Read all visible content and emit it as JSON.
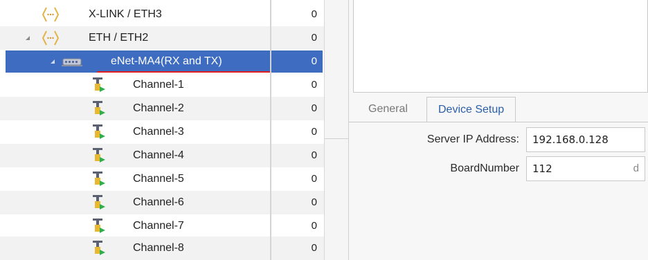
{
  "tree": {
    "rows": [
      {
        "label": "X-LINK / ETH3",
        "count": "0",
        "icon": "link-connection-icon",
        "expander": "none"
      },
      {
        "label": "ETH / ETH2",
        "count": "0",
        "icon": "link-connection-icon",
        "expander": "expanded"
      },
      {
        "label": "eNet-MA4(RX and TX)",
        "count": "0",
        "icon": "device-module-icon",
        "expander": "expanded",
        "selected": true
      },
      {
        "label": "Channel-1",
        "count": "0",
        "icon": "channel-io-icon"
      },
      {
        "label": "Channel-2",
        "count": "0",
        "icon": "channel-io-icon"
      },
      {
        "label": "Channel-3",
        "count": "0",
        "icon": "channel-io-icon"
      },
      {
        "label": "Channel-4",
        "count": "0",
        "icon": "channel-io-icon"
      },
      {
        "label": "Channel-5",
        "count": "0",
        "icon": "channel-io-icon"
      },
      {
        "label": "Channel-6",
        "count": "0",
        "icon": "channel-io-icon"
      },
      {
        "label": "Channel-7",
        "count": "0",
        "icon": "channel-io-icon"
      },
      {
        "label": "Channel-8",
        "count": "0",
        "icon": "channel-io-icon"
      }
    ],
    "selected_color": "#3d6cc0",
    "selected_underline_color": "#e02020"
  },
  "tabs": {
    "general": "General",
    "device_setup": "Device Setup",
    "active": "Device Setup"
  },
  "device_setup": {
    "server_ip_label": "Server IP Address:",
    "server_ip_value": "192.168.0.128",
    "board_number_label": "BoardNumber",
    "board_number_value": "112",
    "board_number_suffix": "d"
  }
}
